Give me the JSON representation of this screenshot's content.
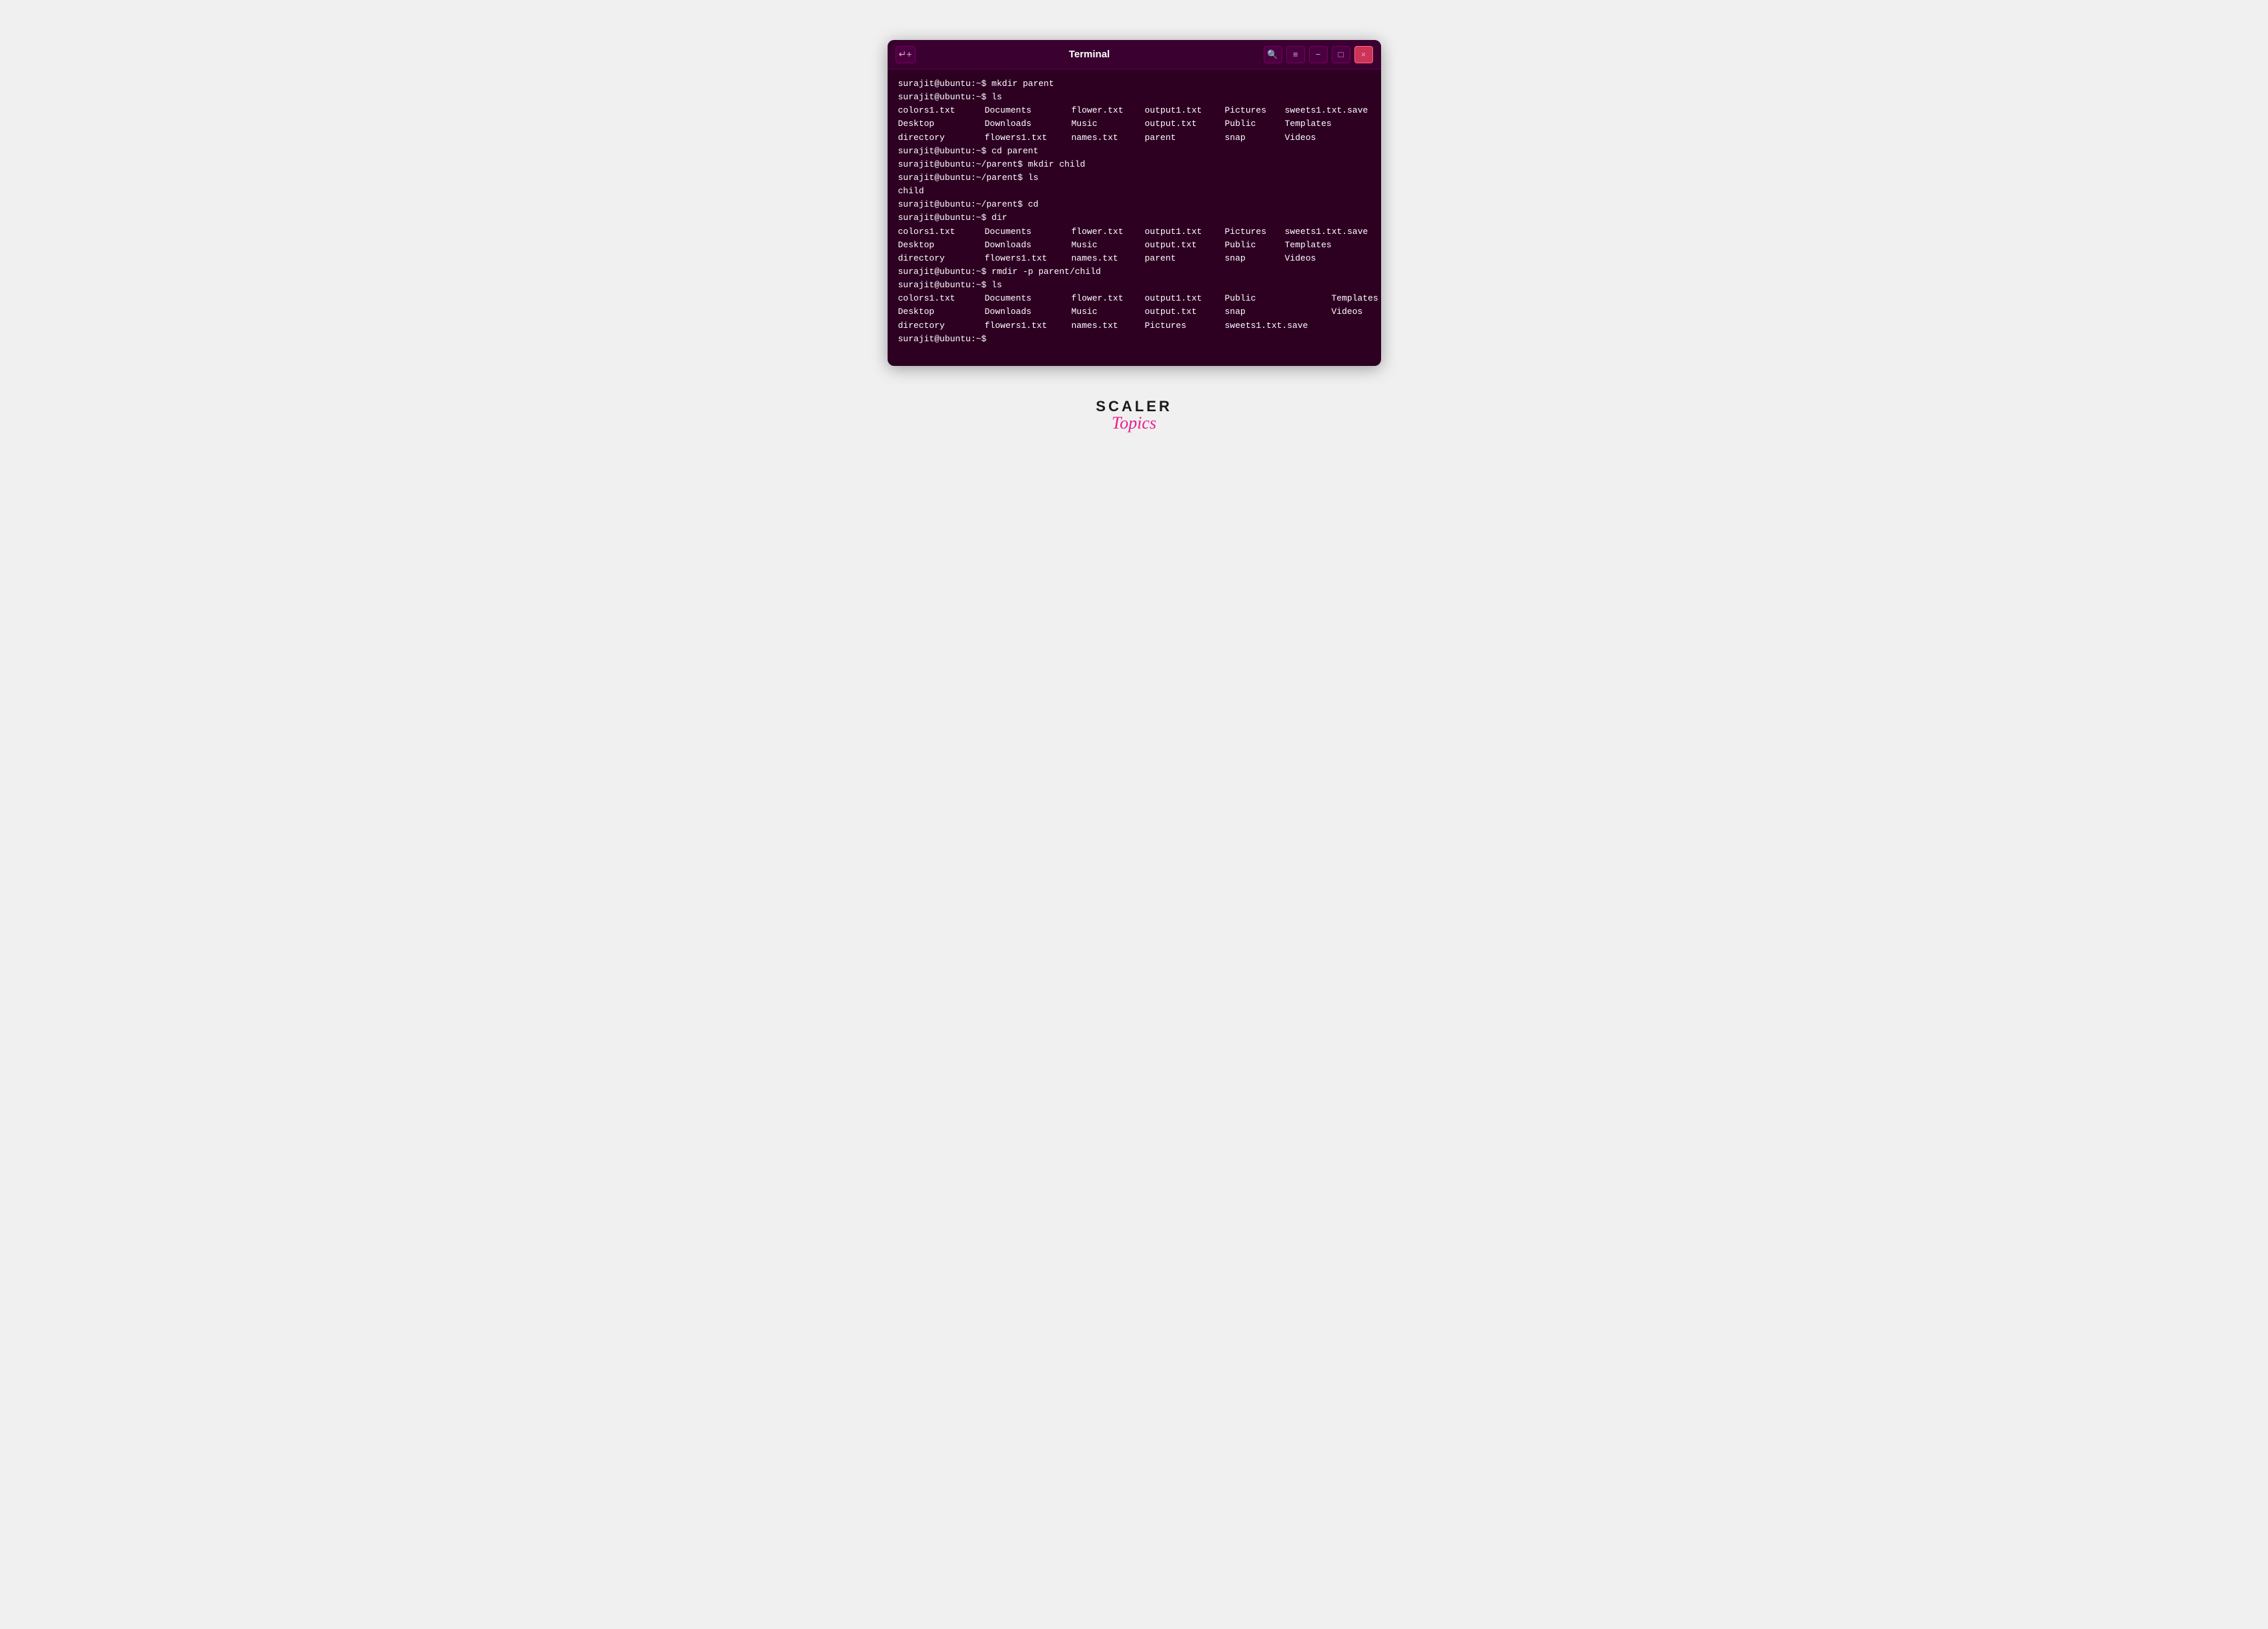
{
  "window": {
    "title": "Terminal",
    "new_tab_label": "↵+",
    "controls": {
      "search": "🔍",
      "menu": "≡",
      "minimize": "−",
      "maximize": "□",
      "close": "×"
    }
  },
  "terminal": {
    "lines": [
      {
        "type": "cmd",
        "text": "surajit@ubuntu:~$ mkdir parent"
      },
      {
        "type": "cmd",
        "text": "surajit@ubuntu:~$ ls"
      },
      {
        "type": "ls3row",
        "rows": [
          [
            "colors1.txt",
            "Documents",
            "flower.txt",
            "output1.txt",
            "Pictures",
            "sweets1.txt.save"
          ],
          [
            "Desktop",
            "Downloads",
            "Music",
            "output.txt",
            "Public",
            "Templates"
          ],
          [
            "directory",
            "flowers1.txt",
            "names.txt",
            "parent",
            "snap",
            "Videos"
          ]
        ]
      },
      {
        "type": "cmd",
        "text": "surajit@ubuntu:~$ cd parent"
      },
      {
        "type": "cmd",
        "text": "surajit@ubuntu:~/parent$ mkdir child"
      },
      {
        "type": "cmd",
        "text": "surajit@ubuntu:~/parent$ ls"
      },
      {
        "type": "single",
        "text": "child"
      },
      {
        "type": "cmd",
        "text": "surajit@ubuntu:~/parent$ cd"
      },
      {
        "type": "cmd",
        "text": "surajit@ubuntu:~$ dir"
      },
      {
        "type": "ls3row",
        "rows": [
          [
            "colors1.txt",
            "Documents",
            "flower.txt",
            "output1.txt",
            "Pictures",
            "sweets1.txt.save"
          ],
          [
            "Desktop",
            "Downloads",
            "Music",
            "output.txt",
            "Public",
            "Templates"
          ],
          [
            "directory",
            "flowers1.txt",
            "names.txt",
            "parent",
            "snap",
            "Videos"
          ]
        ]
      },
      {
        "type": "cmd",
        "text": "surajit@ubuntu:~$ rmdir -p parent/child"
      },
      {
        "type": "cmd",
        "text": "surajit@ubuntu:~$ ls"
      },
      {
        "type": "ls3row2",
        "rows": [
          [
            "colors1.txt",
            "Documents",
            "flower.txt",
            "output1.txt",
            "Public",
            "",
            "Templates"
          ],
          [
            "Desktop",
            "Downloads",
            "Music",
            "output.txt",
            "snap",
            "",
            "Videos"
          ],
          [
            "directory",
            "flowers1.txt",
            "names.txt",
            "Pictures",
            "sweets1.txt.save",
            "",
            ""
          ]
        ]
      },
      {
        "type": "cmd",
        "text": "surajit@ubuntu:~$"
      }
    ]
  },
  "branding": {
    "scaler": "SCALER",
    "topics": "Topics"
  }
}
